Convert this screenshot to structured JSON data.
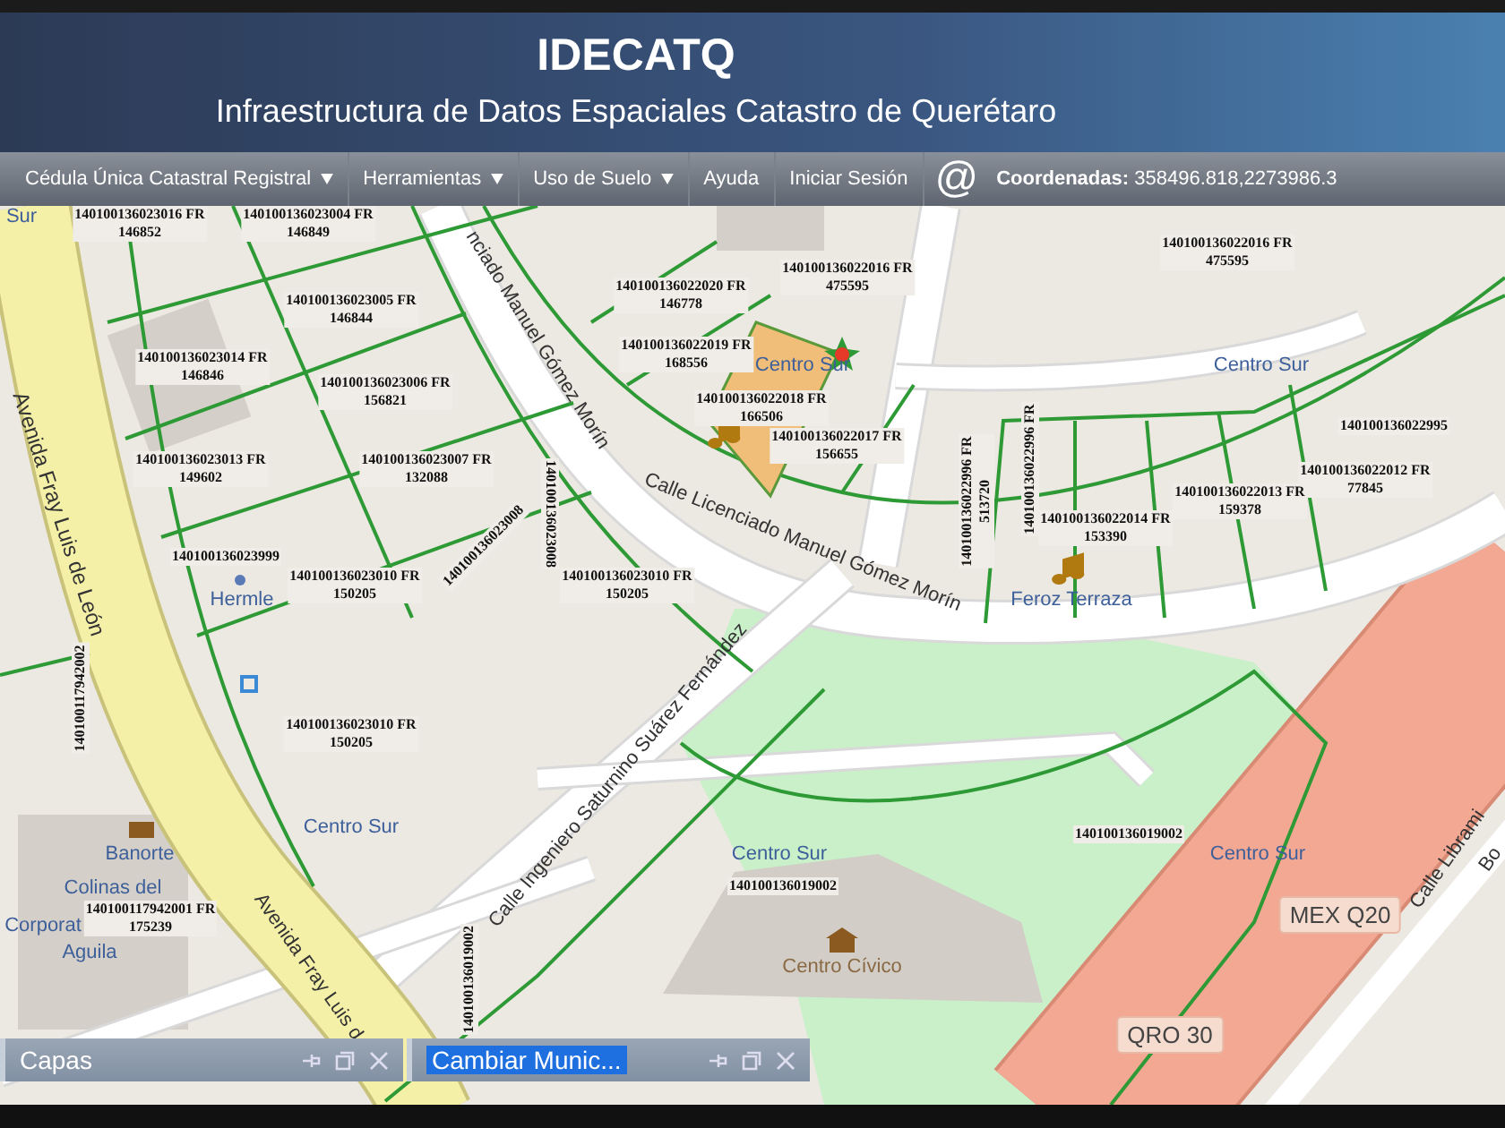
{
  "header": {
    "title": "IDECATQ",
    "subtitle": "Infraestructura de Datos Espaciales Catastro de Querétaro"
  },
  "menu": [
    {
      "label": "Cédula Única Catastral Registral",
      "dropdown": true
    },
    {
      "label": "Herramientas",
      "dropdown": true
    },
    {
      "label": "Uso de Suelo",
      "dropdown": true
    },
    {
      "label": "Ayuda",
      "dropdown": false
    },
    {
      "label": "Iniciar Sesión",
      "dropdown": false
    }
  ],
  "at_button": "@",
  "coordinates": {
    "label": "Coordenadas:",
    "value": "358496.818,2273986.3"
  },
  "map": {
    "streets": [
      "nciado Manuel Gómez Morín",
      "Avenida Fray Luis de León",
      "Calle Licenciado Manuel Gómez Morín",
      "Calle Ingeniero Saturnino Suárez Fernández",
      "Calle Librami",
      "Bo",
      "Avenida Fray Luis d"
    ],
    "places": [
      "Sur",
      "Centro Sur",
      "Centro Sur",
      "Hermle",
      "Feroz Terraza",
      "Centro Sur",
      "Banorte",
      "Centro Sur",
      "Centro Sur",
      "Colinas del",
      "Corporat",
      "Aguila",
      "Centro Cívico"
    ],
    "shields": [
      "MEX Q20",
      "QRO 30"
    ],
    "parcels": [
      {
        "id": "140100136023016 FR",
        "area": "146852",
        "selected": false
      },
      {
        "id": "140100136023004 FR",
        "area": "146849",
        "selected": false
      },
      {
        "id": "140100136022016 FR",
        "area": "475595",
        "selected": false
      },
      {
        "id": "140100136022016 FR",
        "area": "475595",
        "selected": false
      },
      {
        "id": "140100136022020 FR",
        "area": "146778",
        "selected": false
      },
      {
        "id": "140100136023005 FR",
        "area": "146844",
        "selected": false
      },
      {
        "id": "140100136022019 FR",
        "area": "168556",
        "selected": false
      },
      {
        "id": "140100136023014 FR",
        "area": "146846",
        "selected": false
      },
      {
        "id": "140100136023006 FR",
        "area": "156821",
        "selected": false
      },
      {
        "id": "140100136022018 FR",
        "area": "166506",
        "selected": true
      },
      {
        "id": "140100136022995",
        "selected": false
      },
      {
        "id": "140100136022017 FR",
        "area": "156655",
        "selected": false
      },
      {
        "id": "140100136023013 FR",
        "area": "149602",
        "selected": false
      },
      {
        "id": "140100136023007 FR",
        "area": "132088",
        "selected": false
      },
      {
        "id": "140100136022996 FR",
        "selected": false
      },
      {
        "id": "140100136022012 FR",
        "area": "77845",
        "selected": false
      },
      {
        "id": "140100136023008",
        "selected": false
      },
      {
        "id": "140100136022996 FR",
        "area": "513720",
        "selected": false
      },
      {
        "id": "140100136022013 FR",
        "area": "159378",
        "selected": false
      },
      {
        "id": "140100136022014 FR",
        "area": "153390",
        "selected": false
      },
      {
        "id": "140100136023999",
        "selected": false
      },
      {
        "id": "140100136023008",
        "selected": false
      },
      {
        "id": "140100136023010 FR",
        "area": "150205",
        "selected": false
      },
      {
        "id": "140100136023010 FR",
        "area": "150205",
        "selected": false
      },
      {
        "id": "140100117942002",
        "selected": false
      },
      {
        "id": "140100136023010 FR",
        "area": "150205",
        "selected": false
      },
      {
        "id": "140100136019002",
        "selected": false
      },
      {
        "id": "140100136019002",
        "selected": false
      },
      {
        "id": "140100117942001 FR",
        "area": "175239",
        "selected": false
      },
      {
        "id": "140100136019002",
        "selected": false
      }
    ]
  },
  "panels": [
    {
      "title": "Capas",
      "selected": false
    },
    {
      "title": "Cambiar Munic...",
      "selected": true
    }
  ]
}
